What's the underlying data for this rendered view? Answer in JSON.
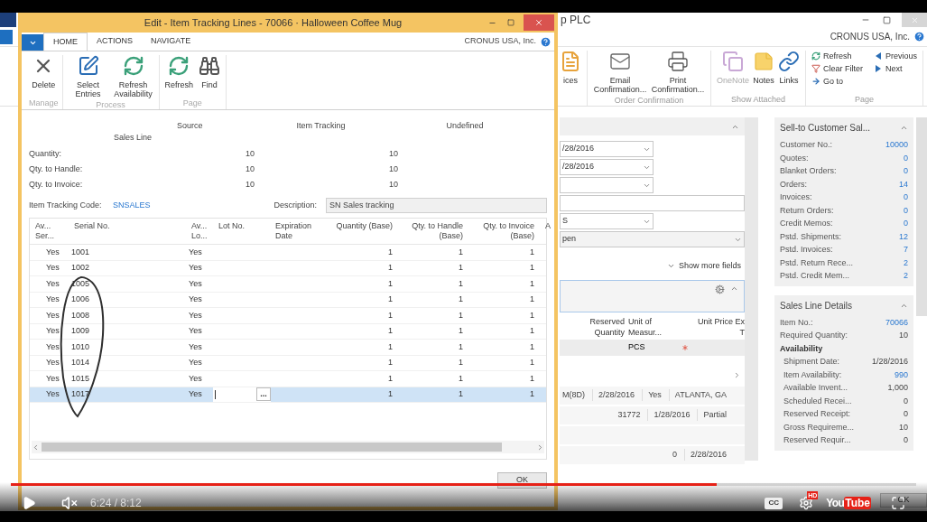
{
  "background_window": {
    "title": "p PLC",
    "company": "CRONUS USA, Inc.",
    "ribbon_groups": [
      {
        "actions": [
          {
            "kind": "invoice",
            "label": "ices",
            "disabled": false
          }
        ]
      },
      {
        "name": "Order Confirmation",
        "actions": [
          {
            "kind": "email",
            "label": "Email Confirmation...",
            "disabled": false
          },
          {
            "kind": "print",
            "label": "Print Confirmation...",
            "disabled": false
          }
        ]
      },
      {
        "name": "Show Attached",
        "actions": [
          {
            "kind": "onenote",
            "label": "OneNote",
            "disabled": true
          },
          {
            "kind": "notes",
            "label": "Notes",
            "disabled": false
          },
          {
            "kind": "links",
            "label": "Links",
            "disabled": false
          }
        ]
      },
      {
        "name": "Page",
        "small_actions": [
          {
            "kind": "refresh",
            "label": "Refresh"
          },
          {
            "kind": "clear_filter",
            "label": "Clear Filter"
          },
          {
            "kind": "goto",
            "label": "Go to"
          },
          {
            "kind": "previous",
            "label": "Previous"
          },
          {
            "kind": "next",
            "label": "Next"
          }
        ]
      }
    ],
    "fields": [
      {
        "kind": "dropdown",
        "value": "/28/2016"
      },
      {
        "kind": "dropdown",
        "value": "/28/2016"
      },
      {
        "kind": "dropdown"
      },
      {
        "kind": "text"
      },
      {
        "kind": "dropdown",
        "value": "S"
      },
      {
        "kind": "wide_dropdown",
        "value": "pen"
      }
    ],
    "show_more": "Show more fields",
    "lines": {
      "columns": [
        {
          "lines": [
            "Reserved",
            "Quantity"
          ]
        },
        {
          "lines": [
            "Unit of",
            "Measur..."
          ]
        },
        {
          "lines": [
            "Unit Price Ex",
            "T"
          ]
        }
      ],
      "row": {
        "unit": "PCS",
        "required": true
      }
    },
    "more_rows": [
      {
        "kind": "values",
        "cells": [
          "M(8D)",
          "2/28/2016",
          "Yes",
          "ATLANTA, GA"
        ]
      },
      {
        "kind": "values",
        "cells": [
          "31772",
          "1/28/2016",
          "Partial"
        ]
      },
      {
        "kind": "empty"
      },
      {
        "kind": "values",
        "cells": [
          "0",
          "2/28/2016"
        ]
      }
    ],
    "factboxes": [
      {
        "title": "Sell-to Customer Sal...",
        "rows": [
          {
            "kind": "link",
            "label": "Customer No.:",
            "value": "10000"
          },
          {
            "kind": "link",
            "label": "Quotes:",
            "value": "0"
          },
          {
            "kind": "link",
            "label": "Blanket Orders:",
            "value": "0"
          },
          {
            "kind": "link",
            "label": "Orders:",
            "value": "14"
          },
          {
            "kind": "link",
            "label": "Invoices:",
            "value": "0"
          },
          {
            "kind": "link",
            "label": "Return Orders:",
            "value": "0"
          },
          {
            "kind": "link",
            "label": "Credit Memos:",
            "value": "0"
          },
          {
            "kind": "link",
            "label": "Pstd. Shipments:",
            "value": "12"
          },
          {
            "kind": "link",
            "label": "Pstd. Invoices:",
            "value": "7"
          },
          {
            "kind": "link",
            "label": "Pstd. Return Rece...",
            "value": "2"
          },
          {
            "kind": "link",
            "label": "Pstd. Credit Mem...",
            "value": "2"
          }
        ]
      },
      {
        "title": "Sales Line Details",
        "rows": [
          {
            "kind": "link",
            "label": "Item No.:",
            "value": "70066"
          },
          {
            "kind": "plain",
            "label": "Required Quantity:",
            "value": "10"
          },
          {
            "kind": "heading",
            "label": "Availability"
          },
          {
            "kind": "sub",
            "label": "Shipment Date:",
            "value": "1/28/2016"
          },
          {
            "kind": "sublink",
            "label": "Item Availability:",
            "value": "990"
          },
          {
            "kind": "sub",
            "label": "Available Invent...",
            "value": "1,000"
          },
          {
            "kind": "sub",
            "label": "Scheduled Recei...",
            "value": "0"
          },
          {
            "kind": "sub",
            "label": "Reserved Receipt:",
            "value": "0"
          },
          {
            "kind": "sub",
            "label": "Gross Requireme...",
            "value": "10"
          },
          {
            "kind": "sub",
            "label": "Reserved Requir...",
            "value": "0"
          }
        ]
      }
    ],
    "ok_button": "OK"
  },
  "dialog": {
    "title": "Edit - Item Tracking Lines - 70066 · Halloween Coffee Mug",
    "company": "CRONUS USA, Inc.",
    "tabs": [
      {
        "label": "HOME",
        "selected": true
      },
      {
        "label": "ACTIONS",
        "selected": false
      },
      {
        "label": "NAVIGATE",
        "selected": false
      }
    ],
    "ribbon_groups": [
      {
        "name": "Manage",
        "actions": [
          {
            "kind": "delete",
            "label": "Delete"
          }
        ]
      },
      {
        "name": "Process",
        "actions": [
          {
            "kind": "select_entries",
            "label": "Select Entries"
          },
          {
            "kind": "refresh_availability",
            "label": "Refresh Availability"
          }
        ]
      },
      {
        "name": "Page",
        "actions": [
          {
            "kind": "refresh",
            "label": "Refresh"
          },
          {
            "kind": "find",
            "label": "Find"
          }
        ]
      }
    ],
    "summary": {
      "headers": [
        "Source",
        "Item Tracking",
        "Undefined"
      ],
      "subheader": "Sales Line",
      "rows": [
        {
          "label": "Quantity:",
          "source": "10",
          "tracking": "10"
        },
        {
          "label": "Qty. to Handle:",
          "source": "10",
          "tracking": "10"
        },
        {
          "label": "Qty. to Invoice:",
          "source": "10",
          "tracking": "10"
        }
      ]
    },
    "tracking_code": {
      "label": "Item Tracking Code:",
      "value": "SNSALES"
    },
    "description": {
      "label": "Description:",
      "value": "SN Sales tracking"
    },
    "table": {
      "columns": [
        {
          "lines": [
            "Av...",
            "Ser..."
          ]
        },
        {
          "lines": [
            "Serial No."
          ]
        },
        {
          "lines": [
            "Av...",
            "Lo..."
          ]
        },
        {
          "lines": [
            "Lot No."
          ]
        },
        {
          "lines": [
            "Expiration",
            "Date"
          ]
        },
        {
          "lines": [
            "Quantity (Base)"
          ]
        },
        {
          "lines": [
            "Qty. to Handle",
            "(Base)"
          ]
        },
        {
          "lines": [
            "Qty. to Invoice",
            "(Base)"
          ]
        },
        {
          "lines": [
            "A"
          ]
        }
      ],
      "lookup_button": "...",
      "rows": [
        {
          "av_serial": "Yes",
          "serial": "1001",
          "av_lot": "Yes",
          "qty": "1",
          "handle": "1",
          "invoice": "1",
          "selected": false
        },
        {
          "av_serial": "Yes",
          "serial": "1002",
          "av_lot": "Yes",
          "qty": "1",
          "handle": "1",
          "invoice": "1",
          "selected": false
        },
        {
          "av_serial": "Yes",
          "serial": "1005",
          "av_lot": "Yes",
          "qty": "1",
          "handle": "1",
          "invoice": "1",
          "selected": false
        },
        {
          "av_serial": "Yes",
          "serial": "1006",
          "av_lot": "Yes",
          "qty": "1",
          "handle": "1",
          "invoice": "1",
          "selected": false
        },
        {
          "av_serial": "Yes",
          "serial": "1008",
          "av_lot": "Yes",
          "qty": "1",
          "handle": "1",
          "invoice": "1",
          "selected": false
        },
        {
          "av_serial": "Yes",
          "serial": "1009",
          "av_lot": "Yes",
          "qty": "1",
          "handle": "1",
          "invoice": "1",
          "selected": false
        },
        {
          "av_serial": "Yes",
          "serial": "1010",
          "av_lot": "Yes",
          "qty": "1",
          "handle": "1",
          "invoice": "1",
          "selected": false
        },
        {
          "av_serial": "Yes",
          "serial": "1014",
          "av_lot": "Yes",
          "qty": "1",
          "handle": "1",
          "invoice": "1",
          "selected": false
        },
        {
          "av_serial": "Yes",
          "serial": "1015",
          "av_lot": "Yes",
          "qty": "1",
          "handle": "1",
          "invoice": "1",
          "selected": false
        },
        {
          "av_serial": "Yes",
          "serial": "1017",
          "av_lot": "Yes",
          "qty": "1",
          "handle": "1",
          "invoice": "1",
          "selected": true
        }
      ]
    },
    "ok_button": "OK"
  },
  "video_controls": {
    "progress": {
      "level": 0.78
    },
    "time": "6:24 / 8:12",
    "cc": "CC",
    "hd_badge": "HD",
    "logo": [
      "You",
      "Tube"
    ]
  }
}
